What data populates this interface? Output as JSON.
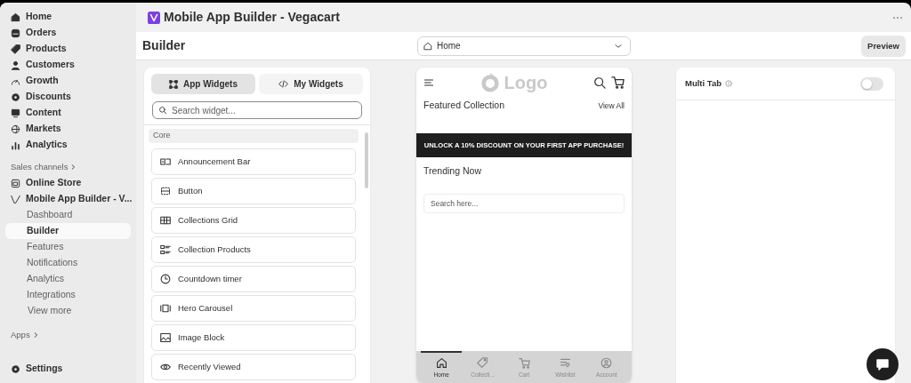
{
  "sidebar": {
    "nav": [
      {
        "label": "Home",
        "selected": false
      },
      {
        "label": "Orders",
        "selected": false
      },
      {
        "label": "Products",
        "selected": false
      },
      {
        "label": "Customers",
        "selected": false
      },
      {
        "label": "Growth",
        "selected": false
      },
      {
        "label": "Discounts",
        "selected": false
      },
      {
        "label": "Content",
        "selected": false
      },
      {
        "label": "Markets",
        "selected": false
      },
      {
        "label": "Analytics",
        "selected": false
      }
    ],
    "sales_channels": {
      "heading": "Sales channels",
      "items": [
        {
          "label": "Online Store"
        },
        {
          "label": "Mobile App Builder - V...",
          "children": [
            {
              "label": "Dashboard",
              "selected": false
            },
            {
              "label": "Builder",
              "selected": true
            },
            {
              "label": "Features",
              "selected": false
            },
            {
              "label": "Notifications",
              "selected": false
            },
            {
              "label": "Analytics",
              "selected": false
            },
            {
              "label": "Integrations",
              "selected": false
            }
          ],
          "more": "View more"
        }
      ]
    },
    "apps": {
      "heading": "Apps"
    },
    "settings": {
      "label": "Settings"
    }
  },
  "app_bar": {
    "title": "Mobile App Builder - Vegacart"
  },
  "header": {
    "title": "Builder",
    "page_select": {
      "value": "Home"
    },
    "preview_button": "Preview"
  },
  "widgets_panel": {
    "tabs": [
      {
        "label": "App Widgets",
        "selected": true
      },
      {
        "label": "My Widgets",
        "selected": false
      }
    ],
    "search": {
      "placeholder": "Search widget..."
    },
    "group": "Core",
    "items": [
      {
        "label": "Announcement Bar"
      },
      {
        "label": "Button"
      },
      {
        "label": "Collections Grid"
      },
      {
        "label": "Collection Products"
      },
      {
        "label": "Countdown timer"
      },
      {
        "label": "Hero Carousel"
      },
      {
        "label": "Image Block"
      },
      {
        "label": "Recently Viewed"
      }
    ]
  },
  "phone_preview": {
    "logo": "Logo",
    "featured": {
      "title": "Featured Collection",
      "link": "View All"
    },
    "announcement": "UNLOCK A 10% DISCOUNT ON YOUR FIRST APP PURCHASE!",
    "trending": "Trending Now",
    "search": {
      "placeholder": "Search here..."
    },
    "bottom_nav": [
      {
        "label": "Home",
        "selected": true
      },
      {
        "label": "Collecti...",
        "selected": false
      },
      {
        "label": "Cart",
        "selected": false
      },
      {
        "label": "Wishlist",
        "selected": false
      },
      {
        "label": "Account",
        "selected": false
      }
    ]
  },
  "settings_panel": {
    "title": "Multi Tab",
    "toggle": {
      "on": false
    }
  }
}
